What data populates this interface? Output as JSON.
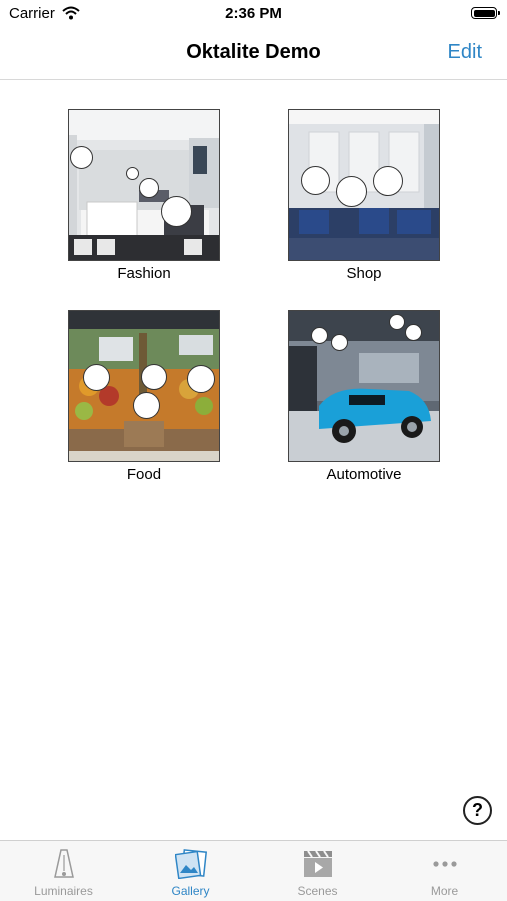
{
  "status": {
    "carrier": "Carrier",
    "time": "2:36 PM"
  },
  "nav": {
    "title": "Oktalite Demo",
    "edit_label": "Edit"
  },
  "gallery": [
    {
      "label": "Fashion"
    },
    {
      "label": "Shop"
    },
    {
      "label": "Food"
    },
    {
      "label": "Automotive"
    }
  ],
  "help": {
    "symbol": "?"
  },
  "tabs": [
    {
      "label": "Luminaires",
      "icon": "luminaire-icon"
    },
    {
      "label": "Gallery",
      "icon": "gallery-icon",
      "active": true
    },
    {
      "label": "Scenes",
      "icon": "clapperboard-icon"
    },
    {
      "label": "More",
      "icon": "more-dots-icon"
    }
  ],
  "colors": {
    "accent": "#2f86c6",
    "tab_inactive": "#9a9a9a"
  }
}
